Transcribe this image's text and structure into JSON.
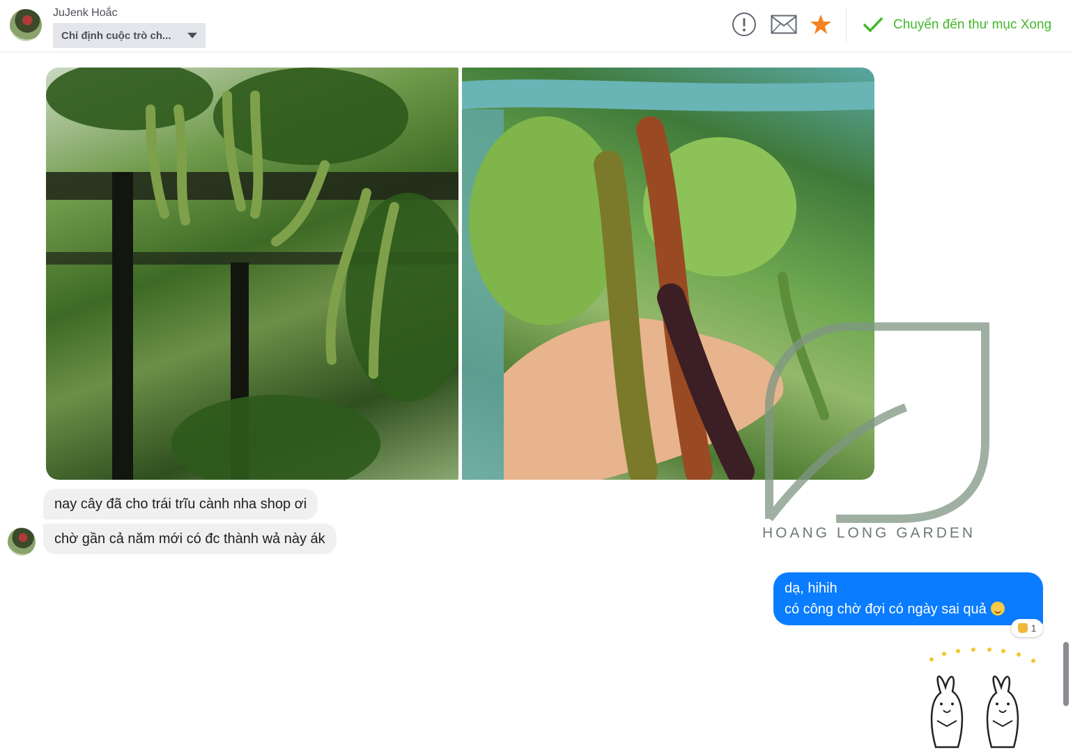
{
  "header": {
    "contact_name": "JuJenk Hoắc",
    "assign_label": "Chỉ định cuộc trò ch...",
    "icons": [
      "alert-icon",
      "mail-icon",
      "star-icon"
    ],
    "done_label": "Chuyển đến thư mục Xong"
  },
  "conversation": {
    "incoming": [
      {
        "text": "nay cây đã cho trái trĩu cành nha shop ơi"
      },
      {
        "text": "chờ gần cả năm mới có đc thành wả này ák"
      }
    ],
    "outgoing": {
      "line1": "dạ, hihih",
      "line2": "có công chờ đợi có ngày sai quả",
      "reaction_count": "1"
    }
  },
  "watermark": {
    "text": "HOANG LONG GARDEN"
  },
  "colors": {
    "outgoing_bubble": "#0a7cff",
    "incoming_bubble": "#f1f0f0",
    "done_green": "#42b72a",
    "star_orange": "#f58220"
  }
}
